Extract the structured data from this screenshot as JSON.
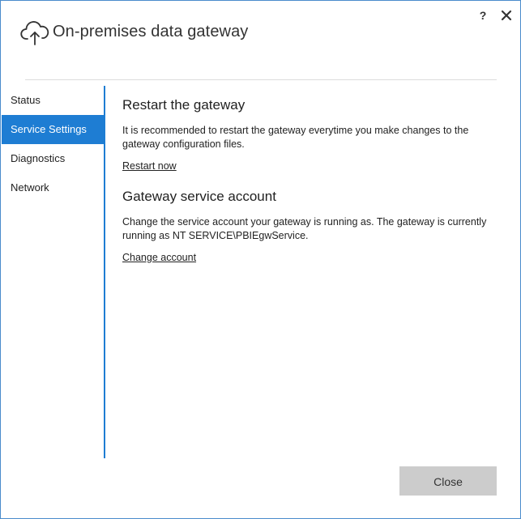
{
  "window": {
    "title": "On-premises data gateway",
    "title_icon": "cloud-upload-icon",
    "help_label": "?",
    "close_icon": "close-icon"
  },
  "sidebar": {
    "items": [
      {
        "label": "Status",
        "active": false
      },
      {
        "label": "Service Settings",
        "active": true
      },
      {
        "label": "Diagnostics",
        "active": false
      },
      {
        "label": "Network",
        "active": false
      }
    ]
  },
  "main": {
    "restart": {
      "title": "Restart the gateway",
      "description": "It is recommended to restart the gateway everytime you make changes to the gateway configuration files.",
      "link": "Restart now"
    },
    "service_account": {
      "title": "Gateway service account",
      "description": "Change the service account your gateway is running as. The gateway is currently running as NT SERVICE\\PBIEgwService.",
      "link": "Change account"
    }
  },
  "footer": {
    "close_label": "Close"
  },
  "colors": {
    "accent": "#1e7dd3",
    "button_bg": "#cccccc",
    "border": "#4a8ccc"
  }
}
